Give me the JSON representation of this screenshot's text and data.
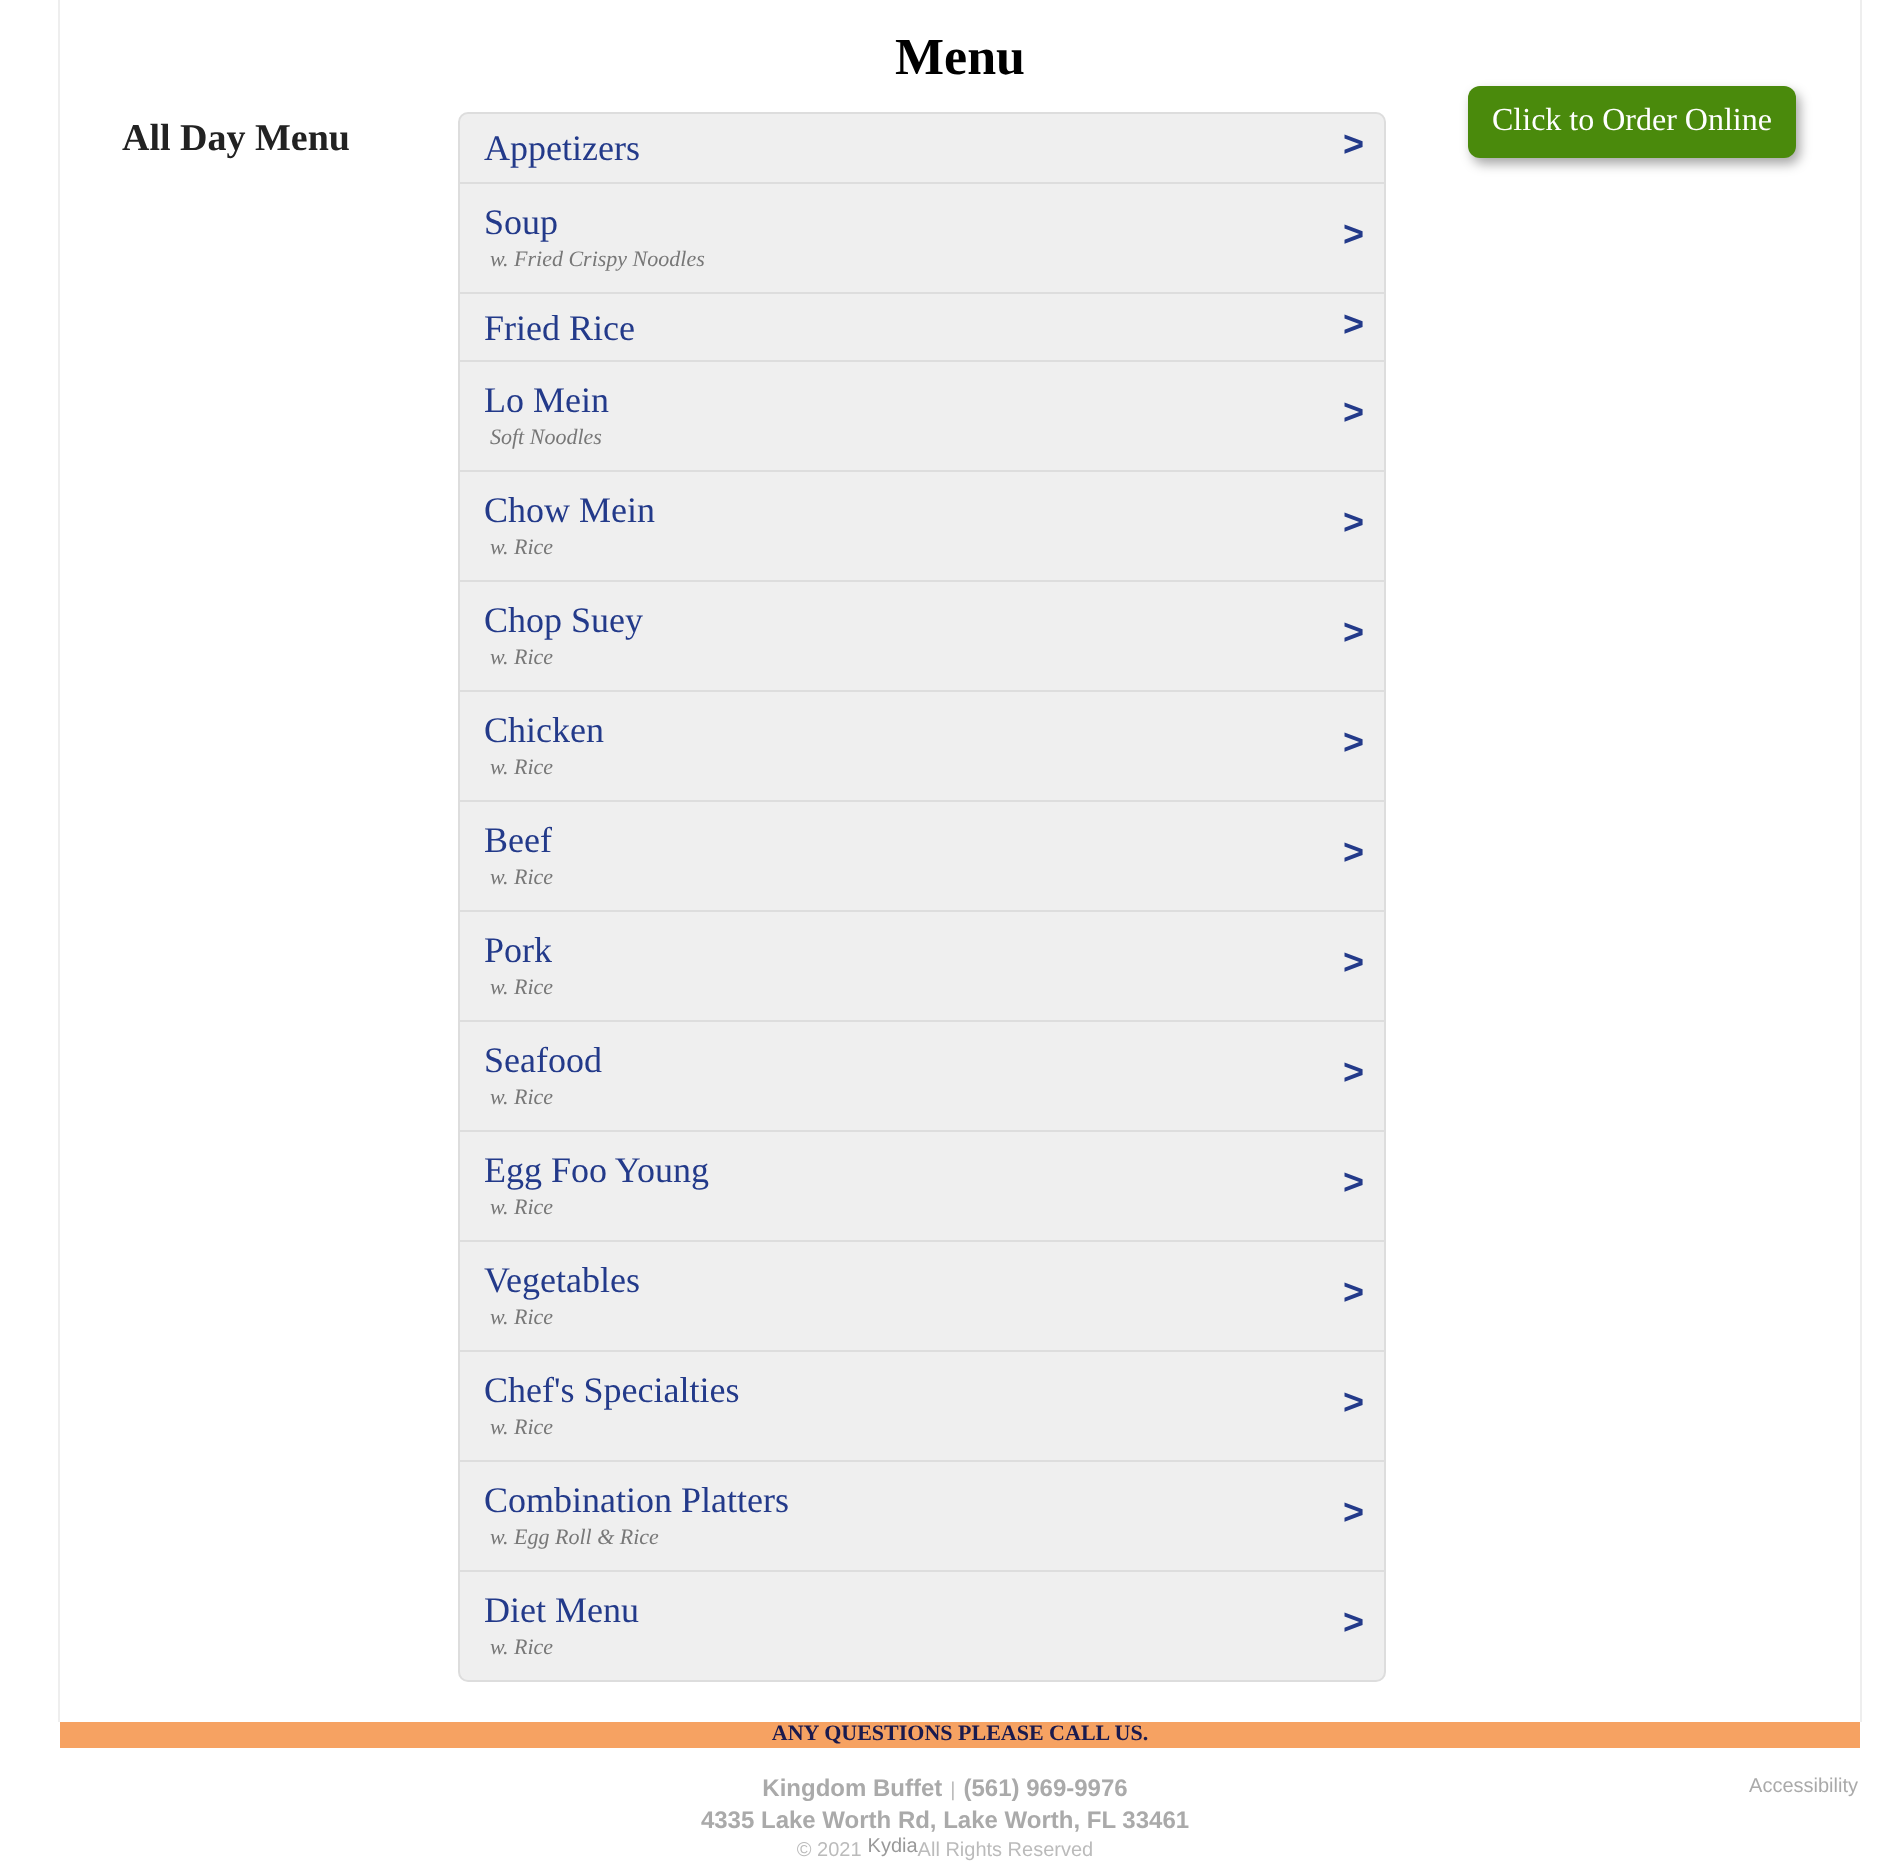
{
  "page_title": "Menu",
  "section_label": "All Day Menu",
  "order_button": "Click to Order Online",
  "categories": [
    {
      "name": "Appetizers",
      "chevron": ">"
    },
    {
      "name": "Soup",
      "note": "w. Fried Crispy Noodles",
      "chevron": ">"
    },
    {
      "name": "Fried Rice",
      "chevron": ">"
    },
    {
      "name": "Lo Mein",
      "note": "Soft Noodles",
      "chevron": ">"
    },
    {
      "name": "Chow Mein",
      "note": "w. Rice",
      "chevron": ">"
    },
    {
      "name": "Chop Suey",
      "note": "w. Rice",
      "chevron": ">"
    },
    {
      "name": "Chicken",
      "note": "w. Rice",
      "chevron": ">"
    },
    {
      "name": "Beef",
      "note": "w. Rice",
      "chevron": ">"
    },
    {
      "name": "Pork",
      "note": "w. Rice",
      "chevron": ">"
    },
    {
      "name": "Seafood",
      "note": "w. Rice",
      "chevron": ">"
    },
    {
      "name": "Egg Foo Young",
      "note": "w. Rice",
      "chevron": ">"
    },
    {
      "name": "Vegetables",
      "note": "w. Rice",
      "chevron": ">"
    },
    {
      "name": "Chef's Specialties",
      "note": "w. Rice",
      "chevron": ">"
    },
    {
      "name": "Combination Platters",
      "note": "w. Egg Roll & Rice",
      "chevron": ">"
    },
    {
      "name": "Diet Menu",
      "note": "w. Rice",
      "chevron": ">"
    }
  ],
  "banner": "ANY QUESTIONS PLEASE CALL US.",
  "footer": {
    "business": "Kingdom Buffet",
    "separator": "|",
    "phone": "(561) 969-9976",
    "address": "4335 Lake Worth Rd, Lake Worth, FL 33461",
    "copyright": "© 2021",
    "brand": "Kydia",
    "rights": "All Rights Reserved",
    "accessibility": "Accessibility"
  }
}
